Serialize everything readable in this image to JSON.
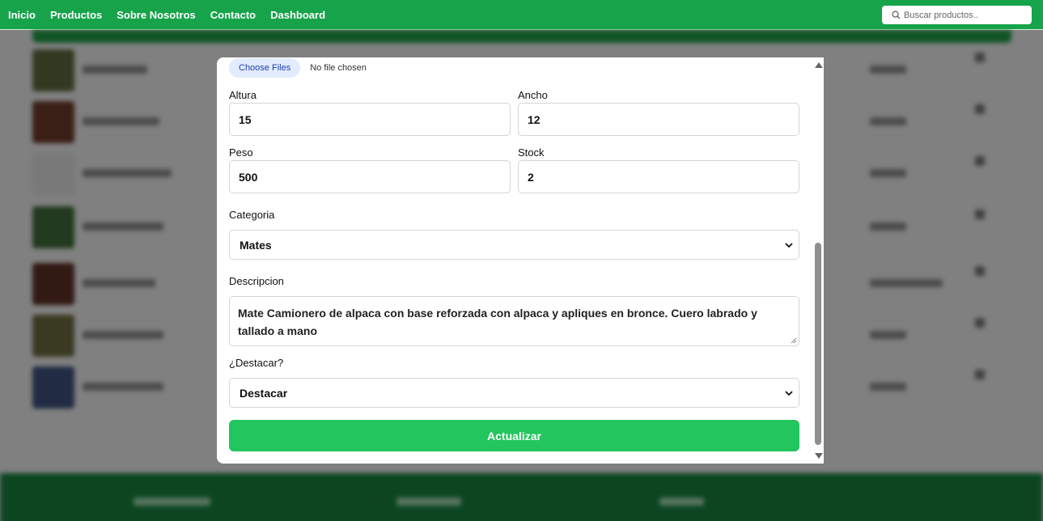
{
  "nav": {
    "links": [
      "Inicio",
      "Productos",
      "Sobre Nosotros",
      "Contacto",
      "Dashboard"
    ],
    "search_placeholder": "Buscar productos.."
  },
  "form": {
    "file_button": "Choose Files",
    "file_status": "No file chosen",
    "altura_label": "Altura",
    "altura_value": "15",
    "ancho_label": "Ancho",
    "ancho_value": "12",
    "peso_label": "Peso",
    "peso_value": "500",
    "stock_label": "Stock",
    "stock_value": "2",
    "categoria_label": "Categoria",
    "categoria_value": "Mates",
    "descripcion_label": "Descripcion",
    "descripcion_value": "Mate Camionero de alpaca con base reforzada con alpaca y apliques en bronce. Cuero labrado y tallado a mano",
    "destacar_label": "¿Destacar?",
    "destacar_value": "Destacar",
    "submit_label": "Actualizar"
  },
  "colors": {
    "navbar": "#16a34a",
    "submit": "#22c55e"
  }
}
